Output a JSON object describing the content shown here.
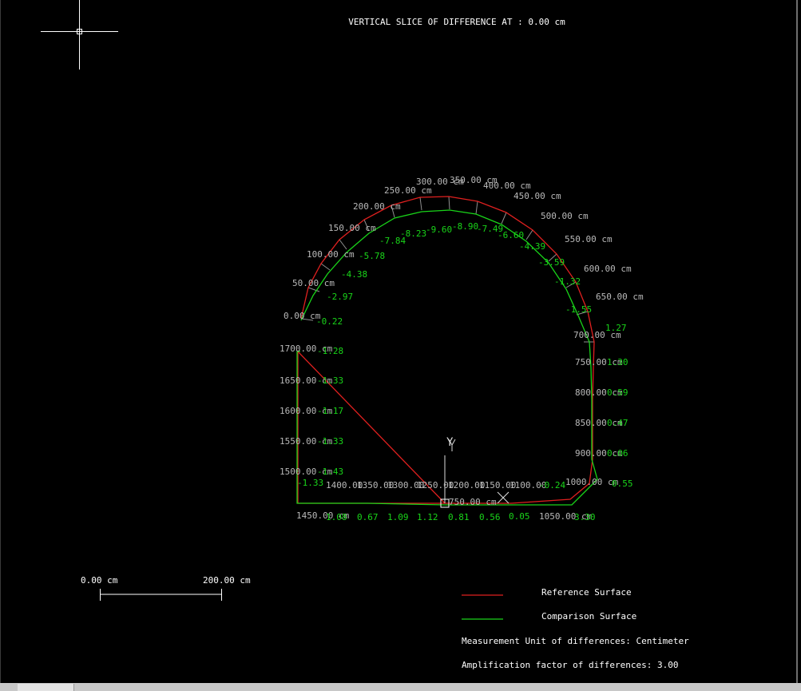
{
  "title": "VERTICAL SLICE OF DIFFERENCE AT : 0.00 cm",
  "axis": {
    "y_label": "Y"
  },
  "scale_bar": {
    "start_label": "0.00  cm",
    "end_label": "200.00  cm"
  },
  "legend": {
    "reference_label": "Reference Surface",
    "comparison_label": "Comparison Surface",
    "reference_color": "#e0201f",
    "comparison_color": "#19d419",
    "unit_text": "Measurement Unit of differences: Centimeter",
    "amplification_text": "Amplification factor of differences: 3.00"
  },
  "station_labels": [
    "0.00  cm",
    "50.00  cm",
    "100.00  cm",
    "150.00  cm",
    "200.00  cm",
    "250.00  cm",
    "300.00  cm",
    "350.00  cm",
    "400.00  cm",
    "450.00  cm",
    "500.00  cm",
    "550.00  cm",
    "600.00  cm",
    "650.00  cm",
    "700.00  cm",
    "750.00  cm",
    "800.00  cm",
    "850.00  cm",
    "900.00  cm",
    "1000.00  cm",
    "1050.00  cm",
    "1100.00",
    "1150.00",
    "1200.00",
    "1250.00",
    "1300.00",
    "1350.00",
    "1400.00",
    "1450.00  cm",
    "1500.00  cm",
    "1550.00  cm",
    "1600.00  cm",
    "1650.00  cm",
    "1700.00  cm",
    "750.00  cm"
  ],
  "difference_values": [
    "-0.22",
    "-2.97",
    "-4.38",
    "-5.78",
    "-7.84",
    "-8.23",
    "-9.60",
    "-8.90",
    "-7.49",
    "-6.60",
    "-4.39",
    "-3.59",
    "-1.32",
    "-1.55",
    "1.27",
    "1.30",
    "0.59",
    "0.47",
    "0.06",
    "0.55",
    "3.30",
    "0.05",
    "0.56",
    "0.81",
    "1.12",
    "1.09",
    "0.67",
    "1.08",
    "-1.33",
    "-1.43",
    "-1.33",
    "-1.17",
    "-1.33",
    "-1.28",
    "-0.24"
  ]
}
